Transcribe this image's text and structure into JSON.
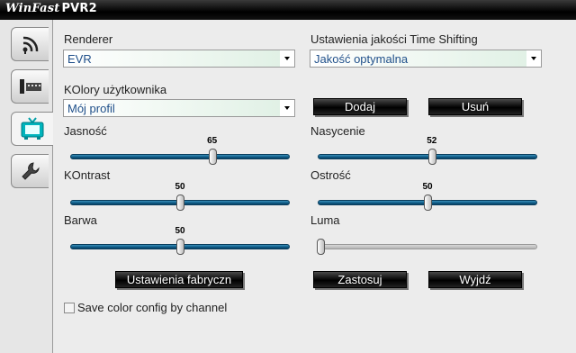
{
  "app": {
    "brand": "WinFast",
    "product": "PVR2"
  },
  "sidebar": {
    "tabs": [
      {
        "name": "antenna",
        "icon": "antenna-icon"
      },
      {
        "name": "recording",
        "icon": "film-icon"
      },
      {
        "name": "display",
        "icon": "tv-icon",
        "active": true
      },
      {
        "name": "settings",
        "icon": "wrench-icon"
      }
    ]
  },
  "renderer": {
    "label": "Renderer",
    "value": "EVR"
  },
  "timeshift": {
    "label": "Ustawienia jakości Time Shifting",
    "value": "Jakość optymalna"
  },
  "user_colors": {
    "label": "KOlory użytkownika",
    "value": "Mój profil"
  },
  "buttons": {
    "add": "Dodaj",
    "remove": "Usuń",
    "defaults": "Ustawienia fabryczn",
    "apply": "Zastosuj",
    "exit": "Wyjdź"
  },
  "sliders": {
    "brightness": {
      "label": "Jasność",
      "value": 65,
      "value_text": "65",
      "max": 100
    },
    "saturation": {
      "label": "Nasycenie",
      "value": 52,
      "value_text": "52",
      "max": 100
    },
    "contrast": {
      "label": "KOntrast",
      "value": 50,
      "value_text": "50",
      "max": 100
    },
    "sharpness": {
      "label": "Ostrość",
      "value": 50,
      "value_text": "50",
      "max": 100
    },
    "hue": {
      "label": "Barwa",
      "value": 50,
      "value_text": "50",
      "max": 100
    },
    "luma": {
      "label": "Luma",
      "value": 0,
      "value_text": "",
      "max": 100,
      "disabled": true
    }
  },
  "save_by_channel": {
    "label": "Save color config by channel",
    "checked": false
  },
  "colors": {
    "track": "#0e5a86",
    "select_text": "#1f4f8a",
    "title_bar": "#000000"
  }
}
